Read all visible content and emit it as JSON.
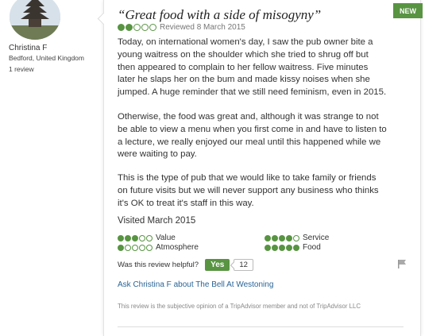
{
  "reviewer": {
    "name": "Christina F",
    "location": "Bedford, United Kingdom",
    "review_count": "1 review",
    "avatar_icon": "temple-photo-avatar"
  },
  "review": {
    "badge": "NEW",
    "title": "“Great food with a side of misogyny”",
    "rating": 2,
    "rating_max": 5,
    "reviewed_date": "Reviewed 8 March 2015",
    "paragraphs": [
      "Today, on international women's day, I saw the pub owner bite a young waitress on the shoulder which she tried to shrug off but then appeared to complain to her fellow waitress. Five minutes later he slaps her on the bum and made kissy noises when she jumped. A huge reminder that we still need feminism, even in 2015.",
      "Otherwise, the food was great and, although it was strange to not be able to view a menu when you first come in and have to listen to a lecture, we really enjoyed our meal until this happened while we were waiting to pay.",
      "This is the type of pub that we would like to take family or friends on future visits but we will never support any business who thinks it's OK to treat it's staff in this way."
    ],
    "visited": "Visited March 2015",
    "sub_ratings": {
      "value": {
        "label": "Value",
        "score": 3
      },
      "atmosphere": {
        "label": "Atmosphere",
        "score": 1
      },
      "service": {
        "label": "Service",
        "score": 4
      },
      "food": {
        "label": "Food",
        "score": 5
      }
    },
    "helpful_question": "Was this review helpful?",
    "yes_label": "Yes",
    "helpful_count": "12",
    "ask_link": "Ask Christina F about The Bell At Westoning",
    "disclaimer": "This review is the subjective opinion of a TripAdvisor member and not of TripAdvisor LLC"
  },
  "colors": {
    "bubble_green": "#589442",
    "link_blue": "#2a6496",
    "badge_green": "#589442"
  }
}
